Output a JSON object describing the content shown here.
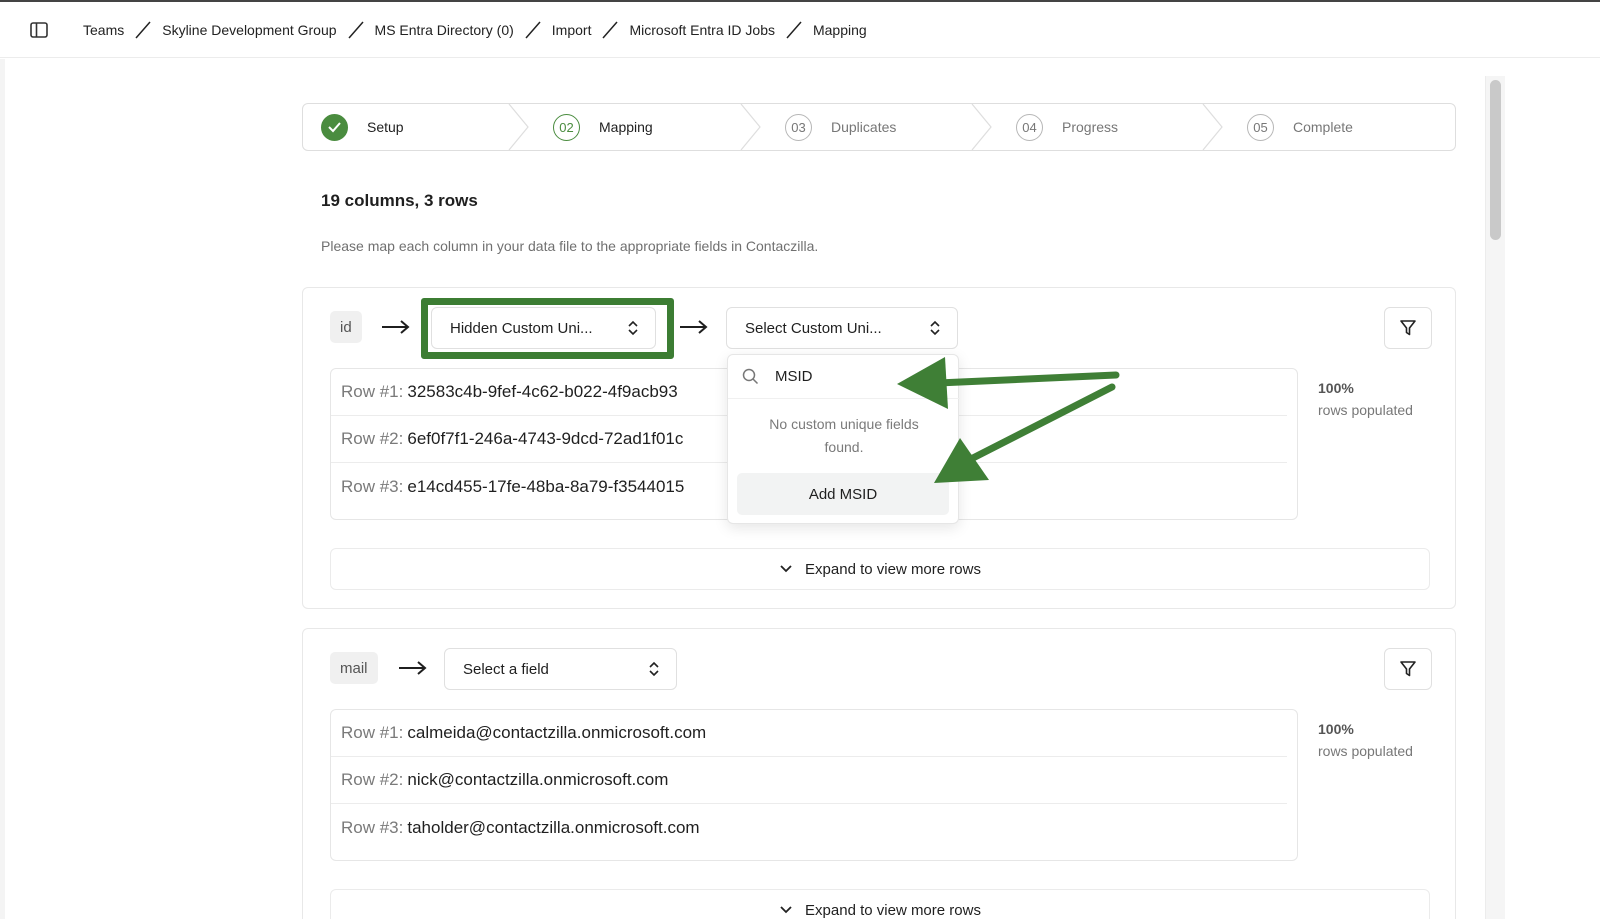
{
  "breadcrumb": [
    "Teams",
    "Skyline Development Group",
    "MS Entra Directory (0)",
    "Import",
    "Microsoft Entra ID Jobs",
    "Mapping"
  ],
  "steps": [
    {
      "number": "",
      "label": "Setup",
      "state": "done"
    },
    {
      "number": "02",
      "label": "Mapping",
      "state": "active"
    },
    {
      "number": "03",
      "label": "Duplicates",
      "state": "pending"
    },
    {
      "number": "04",
      "label": "Progress",
      "state": "pending"
    },
    {
      "number": "05",
      "label": "Complete",
      "state": "pending"
    }
  ],
  "summary": {
    "title": "19 columns, 3 rows",
    "description": "Please map each column in your data file to the appropriate fields in Contaczilla."
  },
  "mappings": [
    {
      "column": "id",
      "field_select": "Hidden Custom Uni...",
      "sub_select": "Select Custom Uni...",
      "rows": [
        {
          "label": "Row #1:",
          "value": "32583c4b-9fef-4c62-b022-4f9acb93"
        },
        {
          "label": "Row #2:",
          "value": "6ef0f7f1-246a-4743-9dcd-72ad1f01c"
        },
        {
          "label": "Row #3:",
          "value": "e14cd455-17fe-48ba-8a79-f3544015"
        }
      ],
      "populated_pct": "100%",
      "populated_label": "rows populated",
      "expand_label": "Expand to view more rows"
    },
    {
      "column": "mail",
      "field_select": "Select a field",
      "rows": [
        {
          "label": "Row #1:",
          "value": "calmeida@contactzilla.onmicrosoft.com"
        },
        {
          "label": "Row #2:",
          "value": "nick@contactzilla.onmicrosoft.com"
        },
        {
          "label": "Row #3:",
          "value": "taholder@contactzilla.onmicrosoft.com"
        }
      ],
      "populated_pct": "100%",
      "populated_label": "rows populated",
      "expand_label": "Expand to view more rows"
    }
  ],
  "dropdown": {
    "search_value": "MSID",
    "empty_message": "No custom unique fields found.",
    "add_label": "Add MSID"
  },
  "colors": {
    "accent_green": "#4a8c3f",
    "highlight_green": "#3c7d33",
    "annotation_arrow": "#3f7f36"
  }
}
